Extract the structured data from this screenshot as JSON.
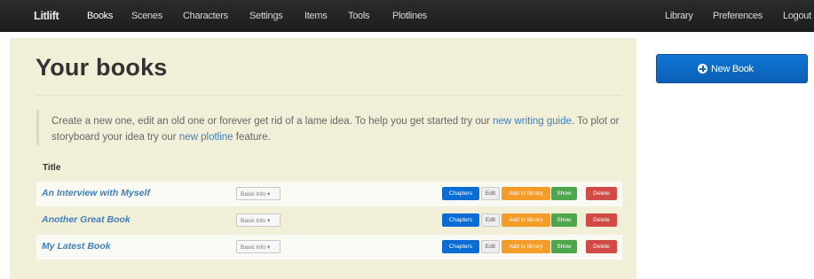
{
  "nav": {
    "brand": "Litlift",
    "items": [
      "Books",
      "Scenes",
      "Characters",
      "Settings",
      "Items",
      "Tools",
      "Plotlines"
    ],
    "right_items": [
      "Library",
      "Preferences",
      "Logout"
    ]
  },
  "main": {
    "title": "Your books",
    "intro": {
      "text1": "Create a new one, edit an old one or forever get rid of a lame idea. To help you get started try our ",
      "link1": "new writing guide",
      "text2": ". To plot or storyboard your idea try our ",
      "link2": "new plotline",
      "text3": " feature."
    },
    "table_header": "Title",
    "books": [
      {
        "title": "An Interview with Myself",
        "info": "Basic info ▾"
      },
      {
        "title": "Another Great Book",
        "info": "Basic info ▾"
      },
      {
        "title": "My Latest Book",
        "info": "Basic info ▾"
      }
    ],
    "row_buttons": {
      "chapters": "Chapters",
      "edit": "Edit",
      "add_library": "Add to library",
      "show": "Show",
      "delete": "Delete"
    }
  },
  "sidebar": {
    "new_book_label": "New Book"
  },
  "colors": {
    "nav_bg": "#1f2022",
    "page_bg": "#f2efd8",
    "link": "#3f7fb8",
    "primary": "#0b6cd4",
    "warning": "#f39c28",
    "success": "#4ca74a",
    "danger": "#d14a45"
  }
}
